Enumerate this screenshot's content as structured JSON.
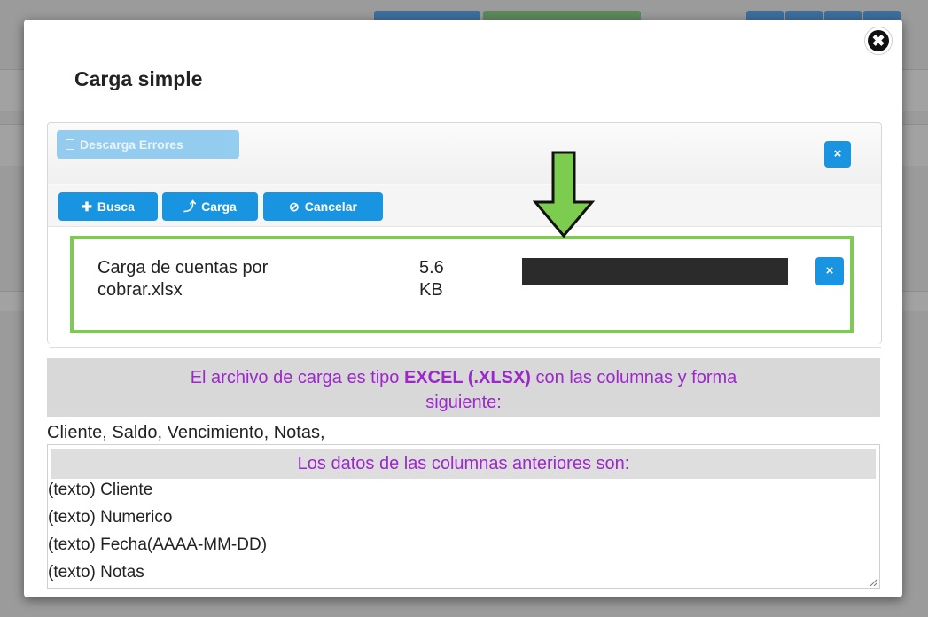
{
  "modal": {
    "title": "Carga simple",
    "close_glyph": "✖",
    "download_errors_label": "Descarga Errores",
    "panel_close_glyph": "×",
    "toolbar": {
      "search_label": "Busca",
      "search_icon": "✚",
      "upload_label": "Carga",
      "upload_icon": "⤴",
      "cancel_label": "Cancelar",
      "cancel_icon": "⊘"
    },
    "file": {
      "name_line1": "Carga de cuentas por",
      "name_line2": "cobrar.xlsx",
      "size_line1": "5.6",
      "size_line2": "KB",
      "remove_glyph": "×"
    },
    "info": {
      "text_before": "El archivo de carga es tipo ",
      "text_bold": "EXCEL (.XLSX)",
      "text_after": " con las columnas y forma",
      "text_line2": "siguiente:"
    },
    "columns_line": "Cliente, Saldo, Vencimiento, Notas,",
    "data_box": {
      "heading": "Los datos de las columnas anteriores son:",
      "lines": [
        "(texto) Cliente",
        "(texto) Numerico",
        "(texto) Fecha(AAAA-MM-DD)",
        "(texto) Notas"
      ]
    }
  },
  "colors": {
    "primary_button": "#1994e0",
    "highlight_border": "#7ccc4f",
    "info_text": "#9b28c9"
  }
}
